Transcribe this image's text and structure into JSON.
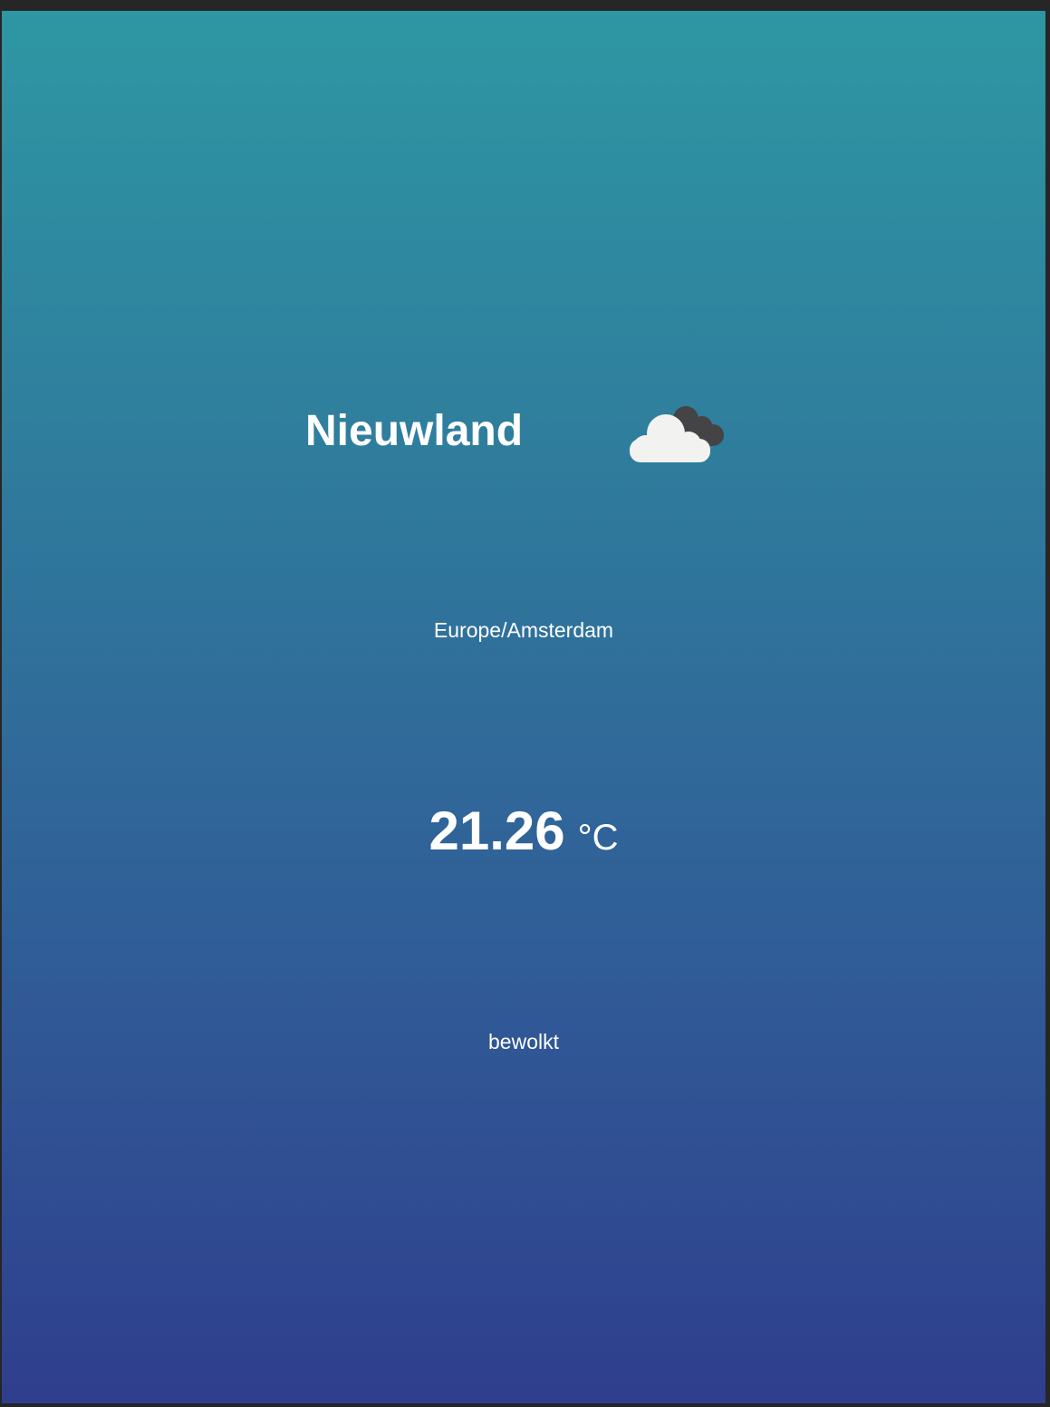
{
  "weather": {
    "city": "Nieuwland",
    "icon": "cloudy-icon",
    "timezone": "Europe/Amsterdam",
    "temperature": "21.26",
    "unit": "°C",
    "description": "bewolkt"
  },
  "colors": {
    "gradient_top": "#2e97a3",
    "gradient_bottom": "#2f3e8d"
  }
}
